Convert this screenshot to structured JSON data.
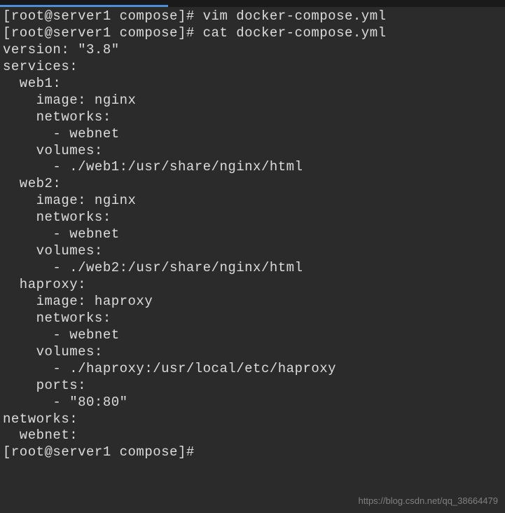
{
  "prompts": {
    "p1_user": "[root@server1 compose]# ",
    "p1_cmd": "vim docker-compose.yml",
    "p2_user": "[root@server1 compose]# ",
    "p2_cmd": "cat docker-compose.yml",
    "p3_user": "[root@server1 compose]# "
  },
  "yaml": {
    "l1": "version: \"3.8\"",
    "l2": "services:",
    "l3": "  web1:",
    "l4": "    image: nginx",
    "l5": "    networks:",
    "l6": "      - webnet",
    "l7": "    volumes:",
    "l8": "      - ./web1:/usr/share/nginx/html",
    "l9": "",
    "l10": "  web2:",
    "l11": "    image: nginx",
    "l12": "    networks:",
    "l13": "      - webnet",
    "l14": "    volumes:",
    "l15": "      - ./web2:/usr/share/nginx/html",
    "l16": "",
    "l17": "  haproxy:",
    "l18": "    image: haproxy",
    "l19": "    networks:",
    "l20": "      - webnet",
    "l21": "    volumes:",
    "l22": "      - ./haproxy:/usr/local/etc/haproxy",
    "l23": "    ports:",
    "l24": "      - \"80:80\"",
    "l25": "",
    "l26": "networks:",
    "l27": "  webnet:"
  },
  "watermark": "https://blog.csdn.net/qq_38664479"
}
